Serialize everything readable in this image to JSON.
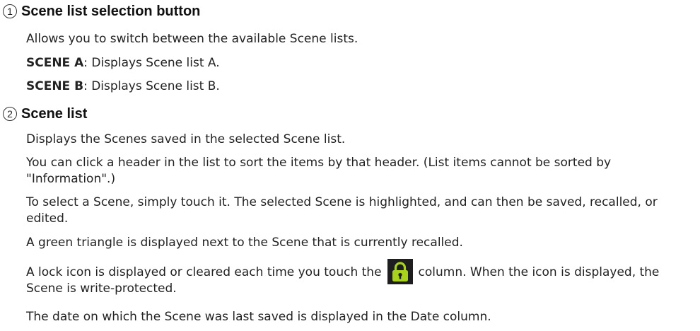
{
  "section1": {
    "number": "1",
    "title": "Scene list selection button",
    "description": "Allows you to switch between the available Scene lists.",
    "items": [
      {
        "term": "SCENE A",
        "sep": ":",
        "text": " Displays Scene list A."
      },
      {
        "term": "SCENE B",
        "sep": ":",
        "text": " Displays Scene list B."
      }
    ]
  },
  "section2": {
    "number": "2",
    "title": "Scene list",
    "paragraphs": [
      "Displays the Scenes saved in the selected Scene list.",
      "You can click a header in the list to sort the items by that header. (List items cannot be sorted by \"Information\".)",
      "To select a Scene, simply touch it. The selected Scene is highlighted, and can then be saved, recalled, or edited.",
      "A green triangle is displayed next to the Scene that is currently recalled."
    ],
    "lock_before": "A lock icon is displayed or cleared each time you touch the",
    "lock_after": "column. When the icon is displayed, the Scene is write-protected.",
    "last_paragraph": "The date on which the Scene was last saved is displayed in the Date column.",
    "lock_icon": "lock-icon",
    "lock_color": "#a8d21e"
  }
}
